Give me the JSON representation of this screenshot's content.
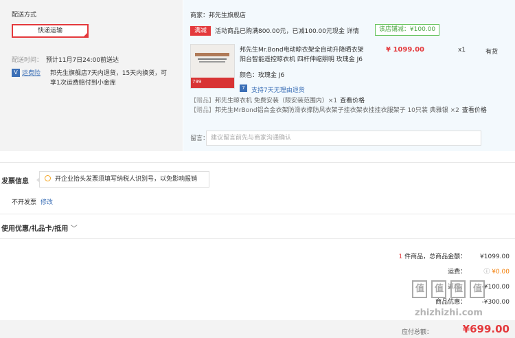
{
  "shipping": {
    "title": "配送方式",
    "method_label": "快递运输",
    "delivery_time_label": "配送时间：",
    "delivery_time_value": "预计11月7日24:00前送达",
    "insurance_badge": "V",
    "insurance_label": "运费险",
    "insurance_desc_line1": "邦先生旗舰店7天内退货，15天内换货，可",
    "insurance_desc_line2": "享1次运费赔付到小金库"
  },
  "store": {
    "header": "商家：邦先生旗舰店",
    "promo_tag": "满减",
    "promo_text": "活动商品已购满800.00元，已减100.00元现金",
    "promo_detail": "详情",
    "promo_badge": "该店铺减：¥100.00"
  },
  "product": {
    "thumb_price": "799",
    "title_line1": "邦先生Mr.Bond电动晾衣架全自动升降晒衣架",
    "title_line2": "阳台智能遥控晾衣机 四杆伸缩照明 玫瑰金 J6",
    "price": "¥ 1099.00",
    "quantity": "x1",
    "stock": "有货",
    "color_label": "颜色：玫瑰金 J6",
    "return_policy": "支持7天无理由退货",
    "return_icon": "7"
  },
  "gifts": [
    {
      "tag": "【赠品】",
      "text": "邦先生晾衣机 免费安装（限安装范围内）×1",
      "link": "查看价格"
    },
    {
      "tag": "【赠品】",
      "text": "邦先生MrBond铝合金衣架防滑衣撑防风衣架子挂衣架衣挂挂衣服架子 10只装 典雅银 ×2",
      "link": "查看价格"
    }
  ],
  "memo": {
    "label": "留言：",
    "placeholder": "建议留言前先与商家沟通确认"
  },
  "invoice": {
    "title": "发票信息",
    "tip": "开企业抬头发票须填写纳税人识别号，以免影响报销",
    "value": "不开发票",
    "edit": "修改"
  },
  "coupons": {
    "title": "使用优惠/礼品卡/抵用",
    "chevron": "﹀"
  },
  "summary": {
    "count": "1",
    "count_suffix": " 件商品，总商品金额：",
    "goods_total": "¥1099.00",
    "shipping_label": "运费：",
    "shipping_value": "¥0.00",
    "discount_label": "返现：",
    "discount_value": "-¥100.00",
    "savings_label": "商品优惠：",
    "savings_value": "-¥300.00",
    "payable_label": "应付总额：",
    "payable_value": "¥699.00"
  },
  "watermark": {
    "glyph": "值",
    "site": "zhizhizhi.com"
  },
  "colors": {
    "accent": "#e4393c",
    "link": "#3b6fb6",
    "green": "#4aa542"
  }
}
